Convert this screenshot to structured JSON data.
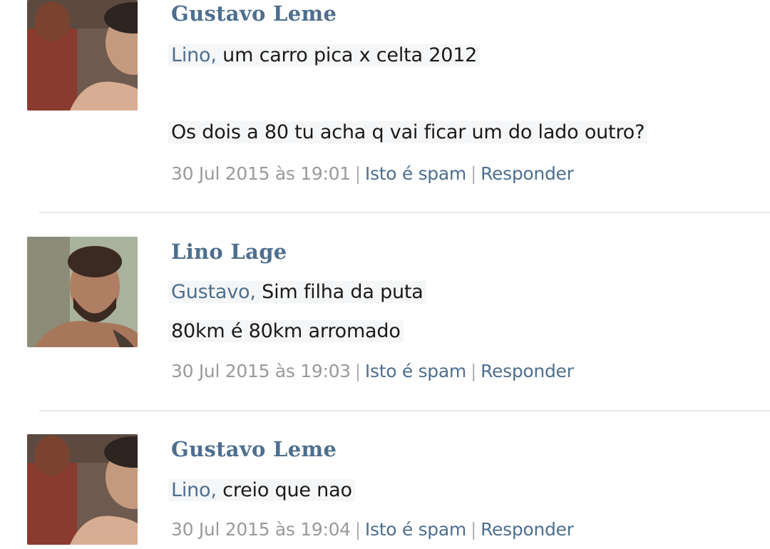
{
  "comments": [
    {
      "author": "Gustavo Leme",
      "mention": "Lino",
      "lines": [
        "um carro pica x celta 2012",
        "Os dois a 80 tu acha q vai ficar um do lado outro?"
      ],
      "timestamp": "30 Jul 2015 às 19:01",
      "spam_label": "Isto é spam",
      "reply_label": "Responder"
    },
    {
      "author": "Lino Lage",
      "mention": "Gustavo",
      "lines": [
        "Sim filha da puta",
        "80km é 80km arromado"
      ],
      "timestamp": "30 Jul 2015 às 19:03",
      "spam_label": "Isto é spam",
      "reply_label": "Responder"
    },
    {
      "author": "Gustavo Leme",
      "mention": "Lino",
      "lines": [
        "creio que nao"
      ],
      "timestamp": "30 Jul 2015 às 19:04",
      "spam_label": "Isto é spam",
      "reply_label": "Responder"
    }
  ],
  "separators": {
    "mention_suffix": ",",
    "meta_sep": "|"
  }
}
